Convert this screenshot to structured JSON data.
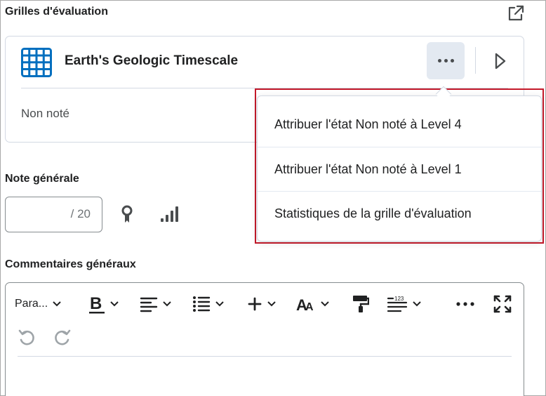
{
  "rubrics": {
    "section_title": "Grilles d'évaluation",
    "popout_icon": "external-link-icon",
    "card": {
      "title": "Earth's Geologic Timescale",
      "status": "Non noté",
      "grid_icon": "rubric-grid-icon",
      "more_icon": "more-horizontal-icon",
      "play_icon": "play-icon"
    },
    "menu": {
      "items": [
        {
          "label": "Attribuer l'état Non noté à Level 4"
        },
        {
          "label": "Attribuer l'état Non noté à Level 1"
        },
        {
          "label": "Statistiques de la grille d'évaluation"
        }
      ]
    }
  },
  "overall_grade": {
    "section_title": "Note générale",
    "value": "",
    "out_of": "/ 20",
    "award_icon": "award-ribbon-icon",
    "stats_icon": "statistics-bars-icon"
  },
  "comments": {
    "section_title": "Commentaires généraux",
    "toolbar": {
      "format_label": "Para...",
      "icons": [
        "bold-icon",
        "align-icon",
        "list-icon",
        "insert-plus-icon",
        "text-size-icon",
        "format-paint-icon",
        "line-spacing-icon",
        "more-icon",
        "fullscreen-icon",
        "undo-icon",
        "redo-icon"
      ]
    }
  },
  "colors": {
    "accent_blue": "#006fbf",
    "highlight_red": "#c4192a",
    "more_button_bg": "#e3e9f1"
  }
}
